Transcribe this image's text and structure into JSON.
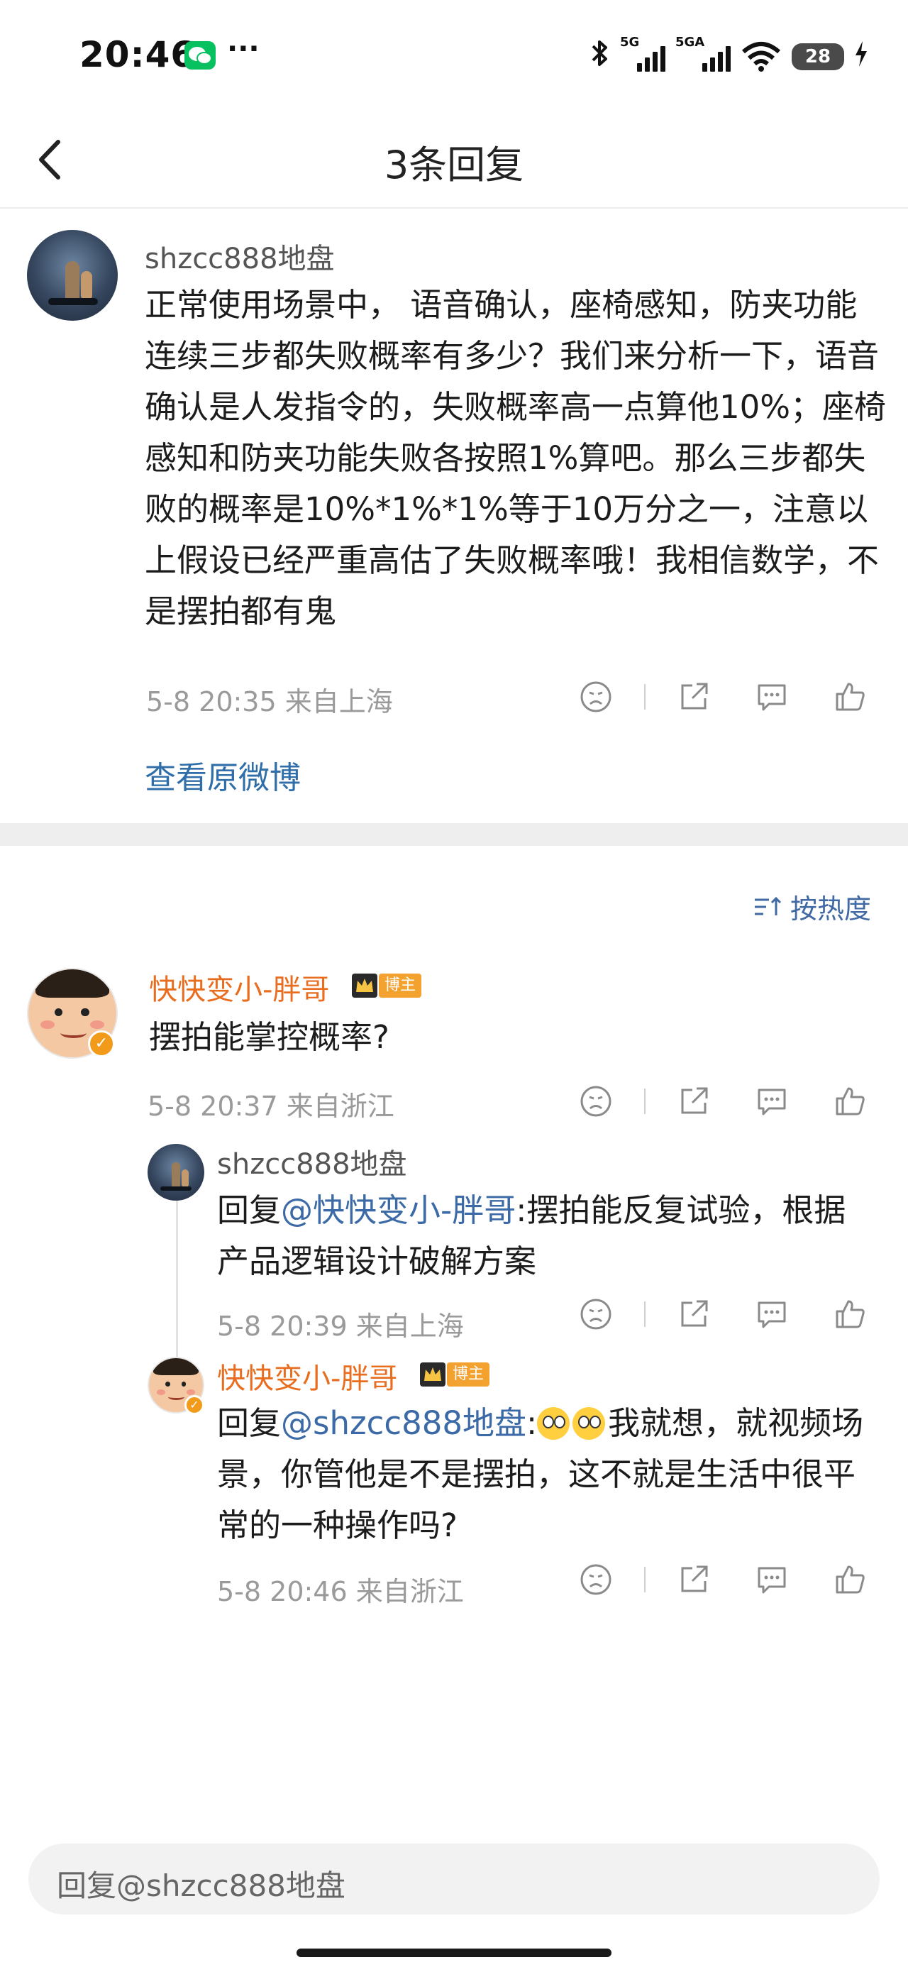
{
  "status_bar": {
    "time": "20:46",
    "signal1_label": "5G",
    "signal2_label": "5GA",
    "battery": "28",
    "icons": [
      "wechat-icon",
      "more-dots-icon",
      "bluetooth-icon",
      "signal-icon",
      "wifi-icon",
      "battery-icon",
      "charging-icon"
    ]
  },
  "nav": {
    "title": "3条回复",
    "back_icon": "chevron-left-icon"
  },
  "post": {
    "user": "shzcc888地盘",
    "text": "正常使用场景中， 语音确认，座椅感知，防夹功能连续三步都失败概率有多少？我们来分析一下，语音确认是人发指令的，失败概率高一点算他10%；座椅感知和防夹功能失败各按照1%算吧。那么三步都失败的概率是10%*1%*1%等于10万分之一，注意以上假设已经严重高估了失败概率哦！我相信数学，不是摆拍都有鬼",
    "meta": "5-8 20:35  来自上海",
    "view_original": "查看原微博"
  },
  "sort_label": "按热度",
  "replies": [
    {
      "user": "快快变小-胖哥",
      "badge": "博主",
      "text": "摆拍能掌控概率?",
      "meta": "5-8 20:37  来自浙江"
    },
    {
      "user": "shzcc888地盘",
      "prefix": "回复",
      "mention": "@快快变小-胖哥",
      "text": ":摆拍能反复试验，根据产品逻辑设计破解方案",
      "meta": "5-8 20:39  来自上海"
    },
    {
      "user": "快快变小-胖哥",
      "badge": "博主",
      "prefix": "回复",
      "mention": "@shzcc888地盘",
      "text_before_emoji": ":",
      "text": "我就想，就视频场景，你管他是不是摆拍，这不就是生活中很平常的一种操作吗?",
      "emoji": [
        "astonished-emoji",
        "astonished-emoji"
      ],
      "meta": "5-8 20:46  来自浙江"
    }
  ],
  "reply_input": {
    "placeholder": "回复@shzcc888地盘"
  },
  "colors": {
    "link_blue": "#2f6ea8",
    "name_orange": "#e86d1f",
    "badge_orange": "#f3a12f",
    "meta_gray": "#9a9a9a"
  }
}
